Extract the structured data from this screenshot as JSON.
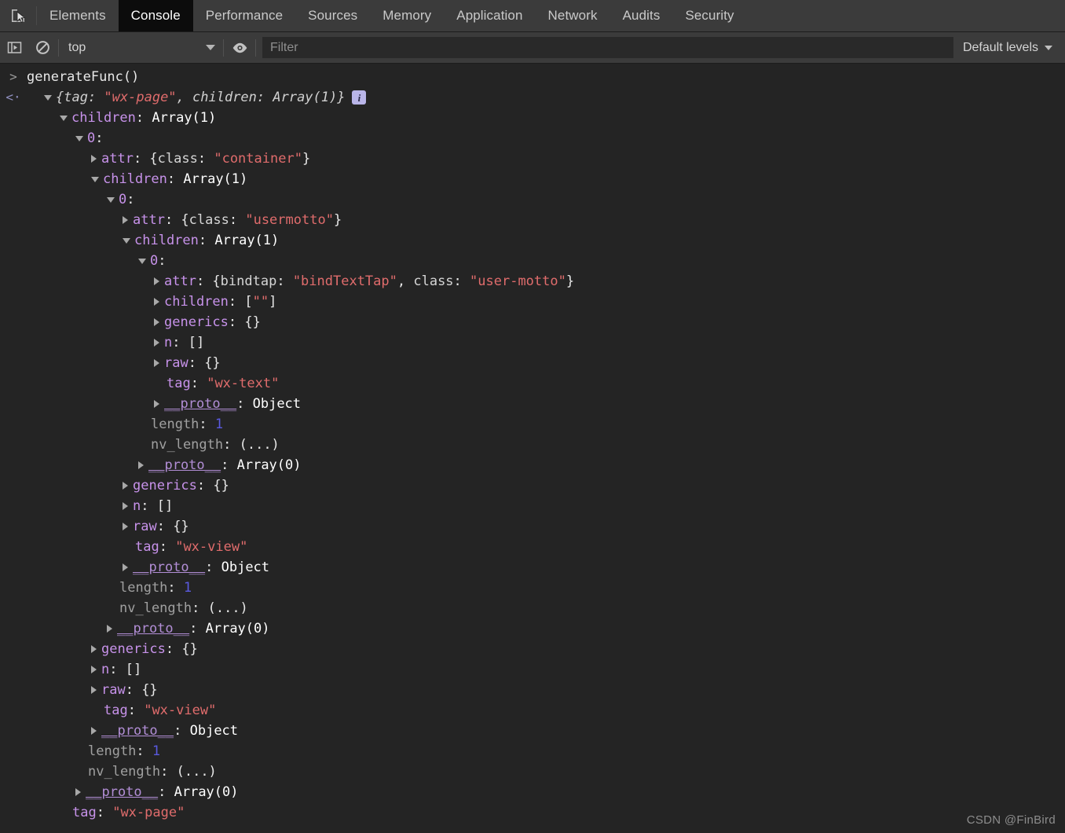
{
  "tabs": [
    {
      "label": "Elements",
      "active": false
    },
    {
      "label": "Console",
      "active": true
    },
    {
      "label": "Performance",
      "active": false
    },
    {
      "label": "Sources",
      "active": false
    },
    {
      "label": "Memory",
      "active": false
    },
    {
      "label": "Application",
      "active": false
    },
    {
      "label": "Network",
      "active": false
    },
    {
      "label": "Audits",
      "active": false
    },
    {
      "label": "Security",
      "active": false
    }
  ],
  "toolbar": {
    "inspect_icon": "inspect-element-icon",
    "sidebar_toggle_icon": "console-sidebar-toggle-icon",
    "clear_icon": "clear-console-icon",
    "context_selected": "top",
    "eye_icon": "live-expression-eye-icon",
    "filter_placeholder": "Filter",
    "filter_value": "",
    "levels_label": "Default levels"
  },
  "console": {
    "input_prompt": ">",
    "input_text": "generateFunc()",
    "output_prompt": "<·",
    "info_badge": "i",
    "lines": [
      {
        "indent": 0,
        "tri": "open",
        "segs": [
          {
            "text": "{tag: ",
            "cls": "t-italic"
          },
          {
            "text": "\"wx-page\"",
            "cls": "t-italic-str"
          },
          {
            "text": ", children: Array(1)}",
            "cls": "t-italic"
          }
        ],
        "badge": true
      },
      {
        "indent": 1,
        "tri": "open",
        "segs": [
          {
            "text": "children",
            "cls": "t-prop"
          },
          {
            "text": ": ",
            "cls": "t-plain"
          },
          {
            "text": "Array(1)",
            "cls": "t-obj"
          }
        ]
      },
      {
        "indent": 2,
        "tri": "open",
        "segs": [
          {
            "text": "0",
            "cls": "t-prop"
          },
          {
            "text": ":",
            "cls": "t-plain"
          }
        ]
      },
      {
        "indent": 3,
        "tri": "closed",
        "segs": [
          {
            "text": "attr",
            "cls": "t-prop"
          },
          {
            "text": ": {",
            "cls": "t-plain"
          },
          {
            "text": "class",
            "cls": "t-key"
          },
          {
            "text": ": ",
            "cls": "t-plain"
          },
          {
            "text": "\"container\"",
            "cls": "t-str"
          },
          {
            "text": "}",
            "cls": "t-plain"
          }
        ]
      },
      {
        "indent": 3,
        "tri": "open",
        "segs": [
          {
            "text": "children",
            "cls": "t-prop"
          },
          {
            "text": ": ",
            "cls": "t-plain"
          },
          {
            "text": "Array(1)",
            "cls": "t-obj"
          }
        ]
      },
      {
        "indent": 4,
        "tri": "open",
        "segs": [
          {
            "text": "0",
            "cls": "t-prop"
          },
          {
            "text": ":",
            "cls": "t-plain"
          }
        ]
      },
      {
        "indent": 5,
        "tri": "closed",
        "segs": [
          {
            "text": "attr",
            "cls": "t-prop"
          },
          {
            "text": ": {",
            "cls": "t-plain"
          },
          {
            "text": "class",
            "cls": "t-key"
          },
          {
            "text": ": ",
            "cls": "t-plain"
          },
          {
            "text": "\"usermotto\"",
            "cls": "t-str"
          },
          {
            "text": "}",
            "cls": "t-plain"
          }
        ]
      },
      {
        "indent": 5,
        "tri": "open",
        "segs": [
          {
            "text": "children",
            "cls": "t-prop"
          },
          {
            "text": ": ",
            "cls": "t-plain"
          },
          {
            "text": "Array(1)",
            "cls": "t-obj"
          }
        ]
      },
      {
        "indent": 6,
        "tri": "open",
        "segs": [
          {
            "text": "0",
            "cls": "t-prop"
          },
          {
            "text": ":",
            "cls": "t-plain"
          }
        ]
      },
      {
        "indent": 7,
        "tri": "closed",
        "segs": [
          {
            "text": "attr",
            "cls": "t-prop"
          },
          {
            "text": ": {",
            "cls": "t-plain"
          },
          {
            "text": "bindtap",
            "cls": "t-key"
          },
          {
            "text": ": ",
            "cls": "t-plain"
          },
          {
            "text": "\"bindTextTap\"",
            "cls": "t-str"
          },
          {
            "text": ", ",
            "cls": "t-plain"
          },
          {
            "text": "class",
            "cls": "t-key"
          },
          {
            "text": ": ",
            "cls": "t-plain"
          },
          {
            "text": "\"user-motto\"",
            "cls": "t-str"
          },
          {
            "text": "}",
            "cls": "t-plain"
          }
        ]
      },
      {
        "indent": 7,
        "tri": "closed",
        "segs": [
          {
            "text": "children",
            "cls": "t-prop"
          },
          {
            "text": ": [",
            "cls": "t-plain"
          },
          {
            "text": "\"\"",
            "cls": "t-str"
          },
          {
            "text": "]",
            "cls": "t-plain"
          }
        ]
      },
      {
        "indent": 7,
        "tri": "closed",
        "segs": [
          {
            "text": "generics",
            "cls": "t-prop"
          },
          {
            "text": ": {}",
            "cls": "t-plain"
          }
        ]
      },
      {
        "indent": 7,
        "tri": "closed",
        "segs": [
          {
            "text": "n",
            "cls": "t-prop"
          },
          {
            "text": ": []",
            "cls": "t-plain"
          }
        ]
      },
      {
        "indent": 7,
        "tri": "closed",
        "segs": [
          {
            "text": "raw",
            "cls": "t-prop"
          },
          {
            "text": ": {}",
            "cls": "t-plain"
          }
        ]
      },
      {
        "indent": 7,
        "tri": "none",
        "segs": [
          {
            "text": "tag",
            "cls": "t-prop"
          },
          {
            "text": ": ",
            "cls": "t-plain"
          },
          {
            "text": "\"wx-text\"",
            "cls": "t-str"
          }
        ]
      },
      {
        "indent": 7,
        "tri": "closed",
        "segs": [
          {
            "text": "__proto__",
            "cls": "t-proto"
          },
          {
            "text": ": ",
            "cls": "t-plain"
          },
          {
            "text": "Object",
            "cls": "t-obj"
          }
        ]
      },
      {
        "indent": 6,
        "tri": "none",
        "segs": [
          {
            "text": "length",
            "cls": "t-dim"
          },
          {
            "text": ": ",
            "cls": "t-plain"
          },
          {
            "text": "1",
            "cls": "t-num"
          }
        ]
      },
      {
        "indent": 6,
        "tri": "none",
        "segs": [
          {
            "text": "nv_length",
            "cls": "t-dim"
          },
          {
            "text": ": ",
            "cls": "t-plain"
          },
          {
            "text": "(...)",
            "cls": "t-plain"
          }
        ]
      },
      {
        "indent": 6,
        "tri": "closed",
        "segs": [
          {
            "text": "__proto__",
            "cls": "t-proto"
          },
          {
            "text": ": ",
            "cls": "t-plain"
          },
          {
            "text": "Array(0)",
            "cls": "t-obj"
          }
        ]
      },
      {
        "indent": 5,
        "tri": "closed",
        "segs": [
          {
            "text": "generics",
            "cls": "t-prop"
          },
          {
            "text": ": {}",
            "cls": "t-plain"
          }
        ]
      },
      {
        "indent": 5,
        "tri": "closed",
        "segs": [
          {
            "text": "n",
            "cls": "t-prop"
          },
          {
            "text": ": []",
            "cls": "t-plain"
          }
        ]
      },
      {
        "indent": 5,
        "tri": "closed",
        "segs": [
          {
            "text": "raw",
            "cls": "t-prop"
          },
          {
            "text": ": {}",
            "cls": "t-plain"
          }
        ]
      },
      {
        "indent": 5,
        "tri": "none",
        "segs": [
          {
            "text": "tag",
            "cls": "t-prop"
          },
          {
            "text": ": ",
            "cls": "t-plain"
          },
          {
            "text": "\"wx-view\"",
            "cls": "t-str"
          }
        ]
      },
      {
        "indent": 5,
        "tri": "closed",
        "segs": [
          {
            "text": "__proto__",
            "cls": "t-proto"
          },
          {
            "text": ": ",
            "cls": "t-plain"
          },
          {
            "text": "Object",
            "cls": "t-obj"
          }
        ]
      },
      {
        "indent": 4,
        "tri": "none",
        "segs": [
          {
            "text": "length",
            "cls": "t-dim"
          },
          {
            "text": ": ",
            "cls": "t-plain"
          },
          {
            "text": "1",
            "cls": "t-num"
          }
        ]
      },
      {
        "indent": 4,
        "tri": "none",
        "segs": [
          {
            "text": "nv_length",
            "cls": "t-dim"
          },
          {
            "text": ": ",
            "cls": "t-plain"
          },
          {
            "text": "(...)",
            "cls": "t-plain"
          }
        ]
      },
      {
        "indent": 4,
        "tri": "closed",
        "segs": [
          {
            "text": "__proto__",
            "cls": "t-proto"
          },
          {
            "text": ": ",
            "cls": "t-plain"
          },
          {
            "text": "Array(0)",
            "cls": "t-obj"
          }
        ]
      },
      {
        "indent": 3,
        "tri": "closed",
        "segs": [
          {
            "text": "generics",
            "cls": "t-prop"
          },
          {
            "text": ": {}",
            "cls": "t-plain"
          }
        ]
      },
      {
        "indent": 3,
        "tri": "closed",
        "segs": [
          {
            "text": "n",
            "cls": "t-prop"
          },
          {
            "text": ": []",
            "cls": "t-plain"
          }
        ]
      },
      {
        "indent": 3,
        "tri": "closed",
        "segs": [
          {
            "text": "raw",
            "cls": "t-prop"
          },
          {
            "text": ": {}",
            "cls": "t-plain"
          }
        ]
      },
      {
        "indent": 3,
        "tri": "none",
        "segs": [
          {
            "text": "tag",
            "cls": "t-prop"
          },
          {
            "text": ": ",
            "cls": "t-plain"
          },
          {
            "text": "\"wx-view\"",
            "cls": "t-str"
          }
        ]
      },
      {
        "indent": 3,
        "tri": "closed",
        "segs": [
          {
            "text": "__proto__",
            "cls": "t-proto"
          },
          {
            "text": ": ",
            "cls": "t-plain"
          },
          {
            "text": "Object",
            "cls": "t-obj"
          }
        ]
      },
      {
        "indent": 2,
        "tri": "none",
        "segs": [
          {
            "text": "length",
            "cls": "t-dim"
          },
          {
            "text": ": ",
            "cls": "t-plain"
          },
          {
            "text": "1",
            "cls": "t-num"
          }
        ]
      },
      {
        "indent": 2,
        "tri": "none",
        "segs": [
          {
            "text": "nv_length",
            "cls": "t-dim"
          },
          {
            "text": ": ",
            "cls": "t-plain"
          },
          {
            "text": "(...)",
            "cls": "t-plain"
          }
        ]
      },
      {
        "indent": 2,
        "tri": "closed",
        "segs": [
          {
            "text": "__proto__",
            "cls": "t-proto"
          },
          {
            "text": ": ",
            "cls": "t-plain"
          },
          {
            "text": "Array(0)",
            "cls": "t-obj"
          }
        ]
      },
      {
        "indent": 1,
        "tri": "none",
        "segs": [
          {
            "text": "tag",
            "cls": "t-prop"
          },
          {
            "text": ": ",
            "cls": "t-plain"
          },
          {
            "text": "\"wx-page\"",
            "cls": "t-str"
          }
        ]
      }
    ]
  },
  "watermark": "CSDN @FinBird"
}
